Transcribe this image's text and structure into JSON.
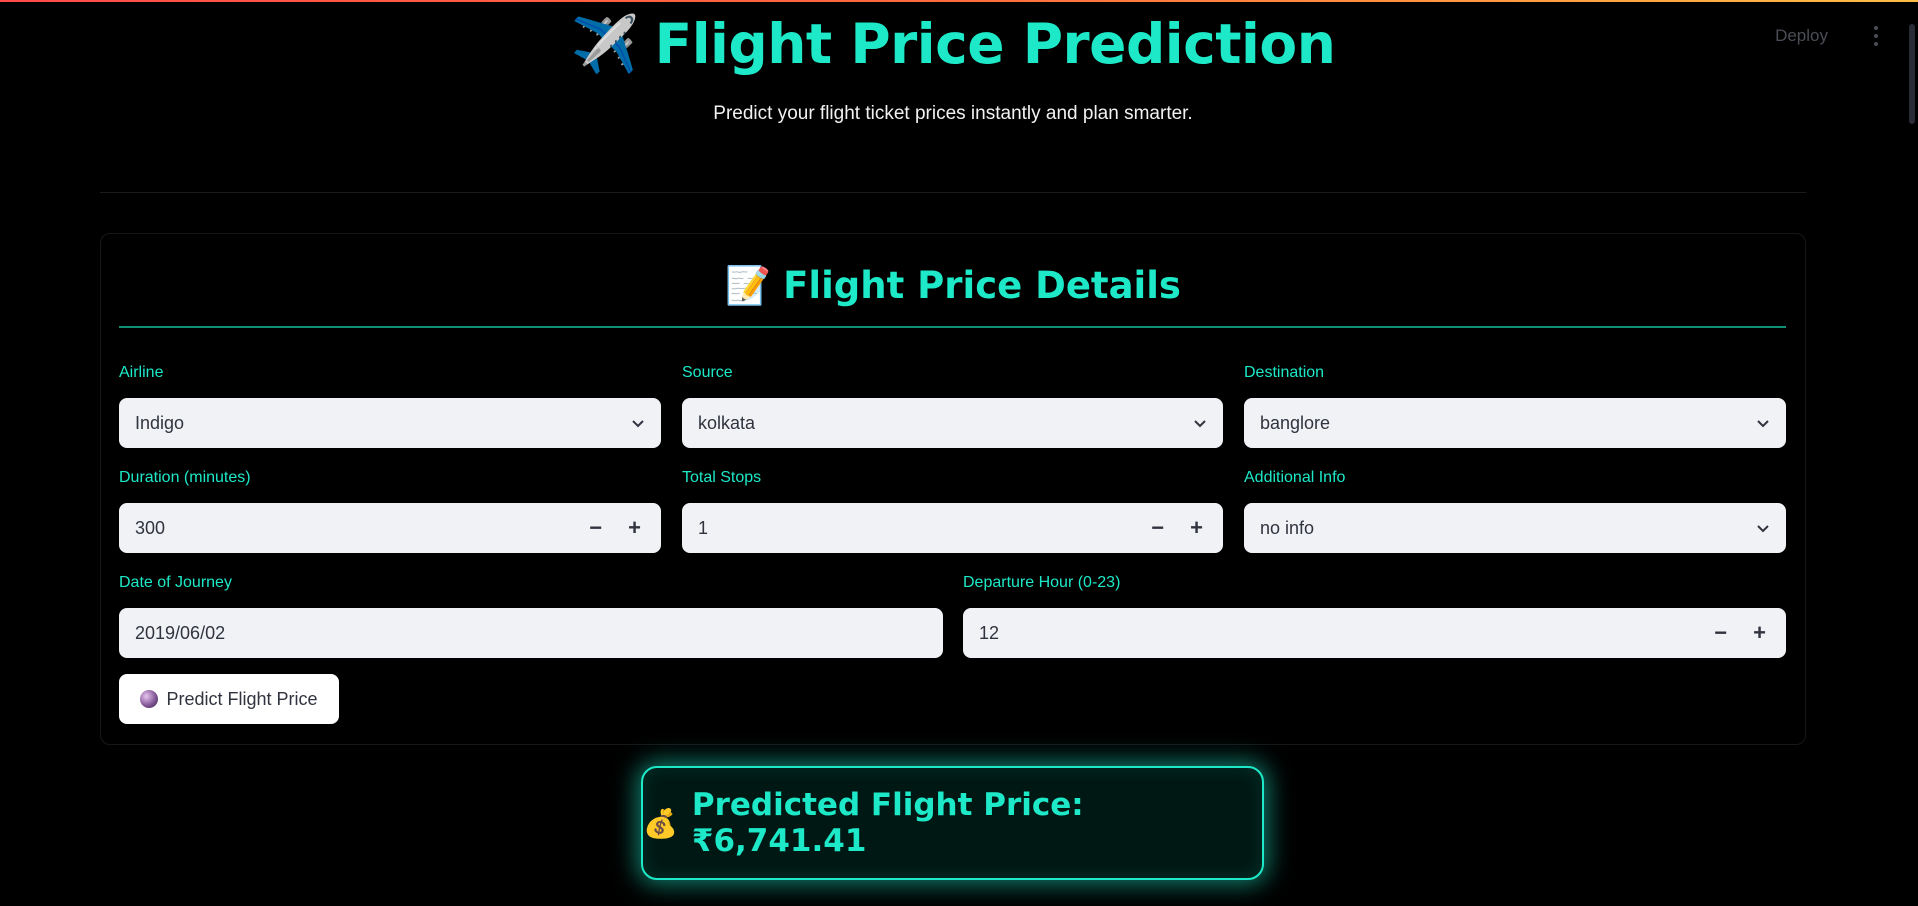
{
  "header": {
    "deploy_label": "Deploy"
  },
  "hero": {
    "plane_icon": "✈️",
    "title": "Flight Price Prediction",
    "subtitle": "Predict your flight ticket prices instantly and plan smarter."
  },
  "form": {
    "heading_icon": "📝",
    "heading": "Flight Price Details",
    "airline": {
      "label": "Airline",
      "value": "Indigo"
    },
    "source": {
      "label": "Source",
      "value": "kolkata"
    },
    "destination": {
      "label": "Destination",
      "value": "banglore"
    },
    "duration": {
      "label": "Duration (minutes)",
      "value": "300"
    },
    "total_stops": {
      "label": "Total Stops",
      "value": "1"
    },
    "additional_info": {
      "label": "Additional Info",
      "value": "no info"
    },
    "date_of_journey": {
      "label": "Date of Journey",
      "value": "2019/06/02"
    },
    "departure_hour": {
      "label": "Departure Hour (0-23)",
      "value": "12"
    },
    "minus_glyph": "−",
    "plus_glyph": "+",
    "predict_button_label": "Predict Flight Price",
    "predict_button_icon": "crystal-ball-icon"
  },
  "result": {
    "icon": "💰",
    "text": "Predicted Flight Price: ₹6,741.41"
  },
  "colors": {
    "accent": "#1de9c8",
    "background": "#000000",
    "input_bg": "#f0f2f6"
  }
}
